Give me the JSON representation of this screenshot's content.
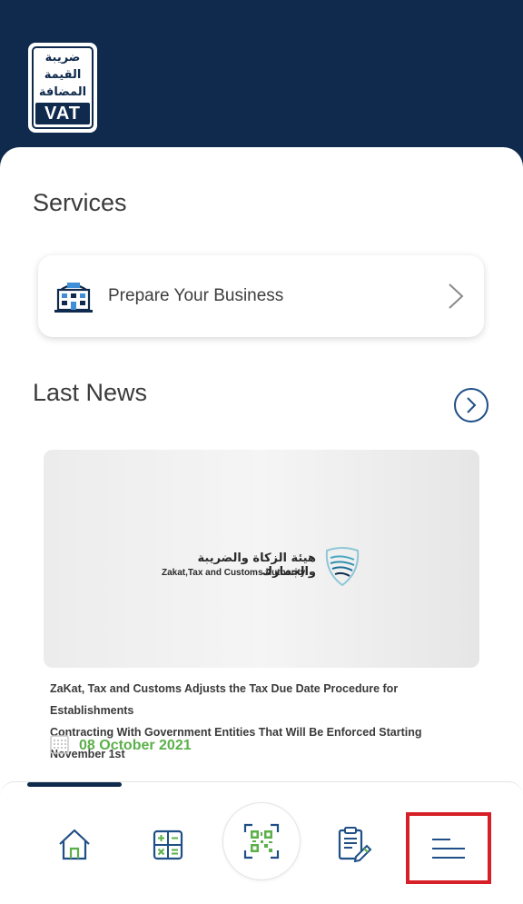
{
  "header": {
    "logo": {
      "arabic_lines": [
        "ضريبة",
        "القيمة",
        "المضافة"
      ],
      "latin": "VAT"
    }
  },
  "services": {
    "title": "Services",
    "items": [
      {
        "label": "Prepare Your Business",
        "icon": "building-icon"
      }
    ]
  },
  "news": {
    "title": "Last News",
    "items": [
      {
        "image_org_arabic": "هيئة الزكاة والضريبة والجمارك",
        "image_org_english": "Zakat,Tax and Customs Authority",
        "headline_line1": "ZaKat, Tax and Customs Adjusts the Tax Due Date Procedure for Establishments",
        "headline_line2": "Contracting With Government Entities That Will Be Enforced Starting November 1st",
        "date": "08 October 2021"
      }
    ]
  },
  "bottom_nav": {
    "items": [
      {
        "id": "home",
        "icon": "home-icon"
      },
      {
        "id": "calculator",
        "icon": "calculator-icon"
      },
      {
        "id": "scan",
        "icon": "qr-scan-icon"
      },
      {
        "id": "reports",
        "icon": "clipboard-edit-icon"
      },
      {
        "id": "menu",
        "icon": "menu-icon"
      }
    ]
  },
  "colors": {
    "navy": "#0f2a4c",
    "accent_blue": "#1f4f86",
    "green": "#5bb04a",
    "highlight_red": "#d61f26"
  }
}
